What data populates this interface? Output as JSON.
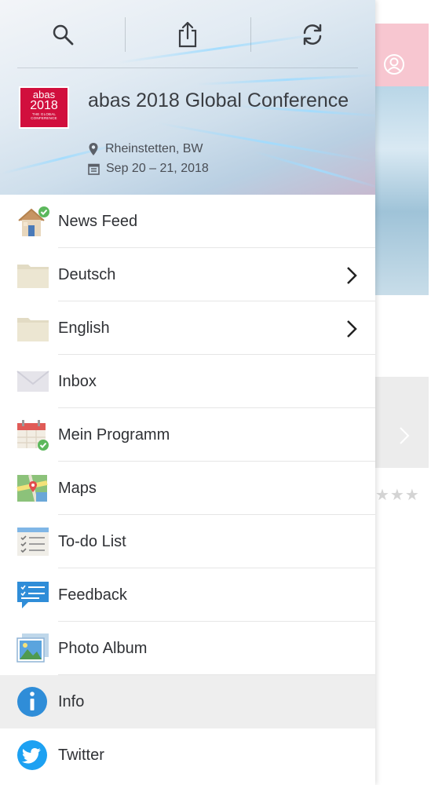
{
  "background_app": {
    "stars": "★★★"
  },
  "header": {
    "toolbar": {
      "search_icon": "search-icon",
      "share_icon": "share-icon",
      "refresh_icon": "refresh-icon"
    },
    "logo": {
      "line1": "abas",
      "line2": "2018",
      "line3": "THE GLOBAL CONFERENCE"
    },
    "title": "abas 2018 Global Conference",
    "location": "Rheinstetten, BW",
    "dates": "Sep 20 – 21, 2018"
  },
  "menu": {
    "items": [
      {
        "label": "News Feed",
        "icon": "house-icon",
        "has_chevron": false,
        "selected": false
      },
      {
        "label": "Deutsch",
        "icon": "folder-icon",
        "has_chevron": true,
        "selected": false
      },
      {
        "label": "English",
        "icon": "folder-icon",
        "has_chevron": true,
        "selected": false
      },
      {
        "label": "Inbox",
        "icon": "envelope-icon",
        "has_chevron": false,
        "selected": false
      },
      {
        "label": "Mein Programm",
        "icon": "calendar-icon",
        "has_chevron": false,
        "selected": false
      },
      {
        "label": "Maps",
        "icon": "map-icon",
        "has_chevron": false,
        "selected": false
      },
      {
        "label": "To-do List",
        "icon": "checklist-icon",
        "has_chevron": false,
        "selected": false
      },
      {
        "label": "Feedback",
        "icon": "feedback-icon",
        "has_chevron": false,
        "selected": false
      },
      {
        "label": "Photo Album",
        "icon": "photo-icon",
        "has_chevron": false,
        "selected": false
      },
      {
        "label": "Info",
        "icon": "info-icon",
        "has_chevron": false,
        "selected": true
      },
      {
        "label": "Twitter",
        "icon": "twitter-icon",
        "has_chevron": false,
        "selected": false
      }
    ]
  },
  "colors": {
    "brand_red": "#d10f3d",
    "twitter_blue": "#1da1f2",
    "info_blue": "#2f8dd8",
    "selected_bg": "#eeeeee"
  }
}
